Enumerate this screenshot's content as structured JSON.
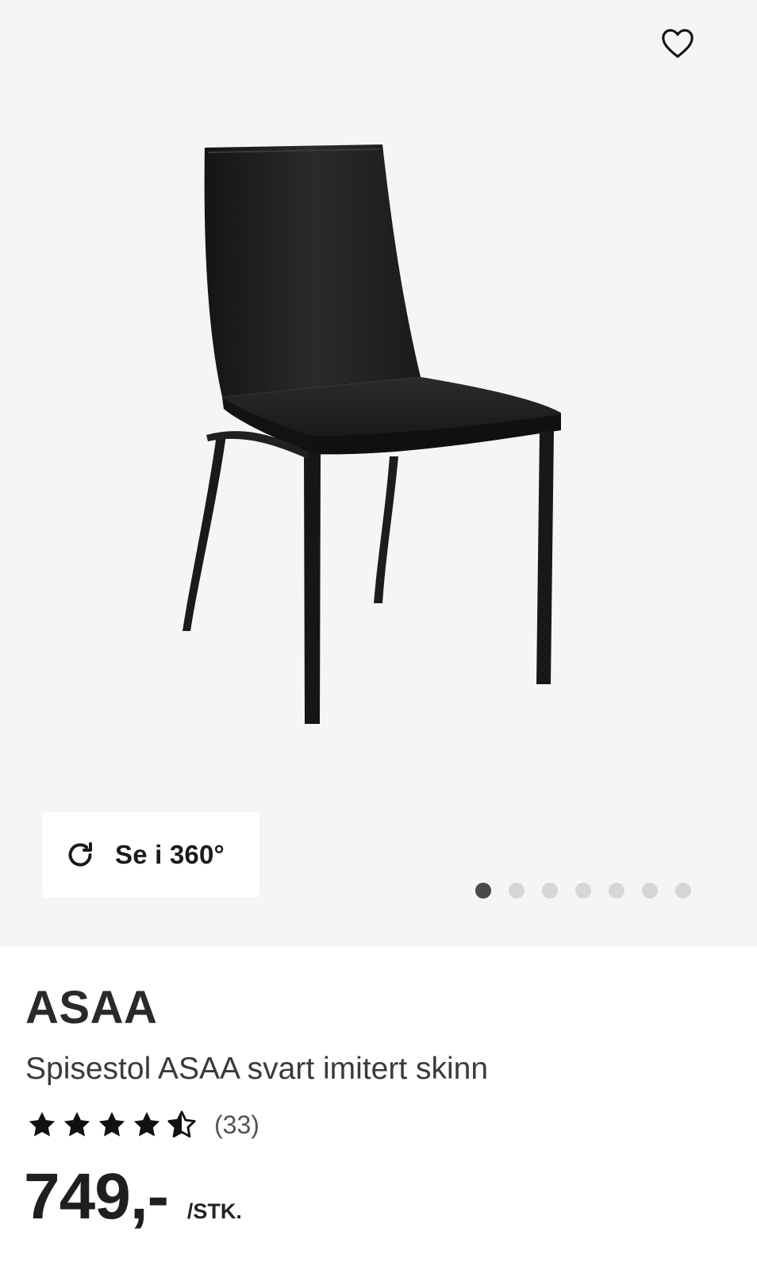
{
  "gallery": {
    "background": "#f5f5f5",
    "favorite_icon": "heart-outline-icon",
    "image_alt": "Spisestol ASAA svart imitert skinn",
    "view360": {
      "icon": "rotate-icon",
      "label": "Se i 360°"
    },
    "carousel": {
      "total": 7,
      "active_index": 0
    }
  },
  "product": {
    "brand": "ASAA",
    "description": "Spisestol ASAA svart imitert skinn",
    "rating": {
      "value": 4.5,
      "max": 5,
      "count_label": "(33)"
    },
    "price": "749,-",
    "unit": "/STK."
  }
}
